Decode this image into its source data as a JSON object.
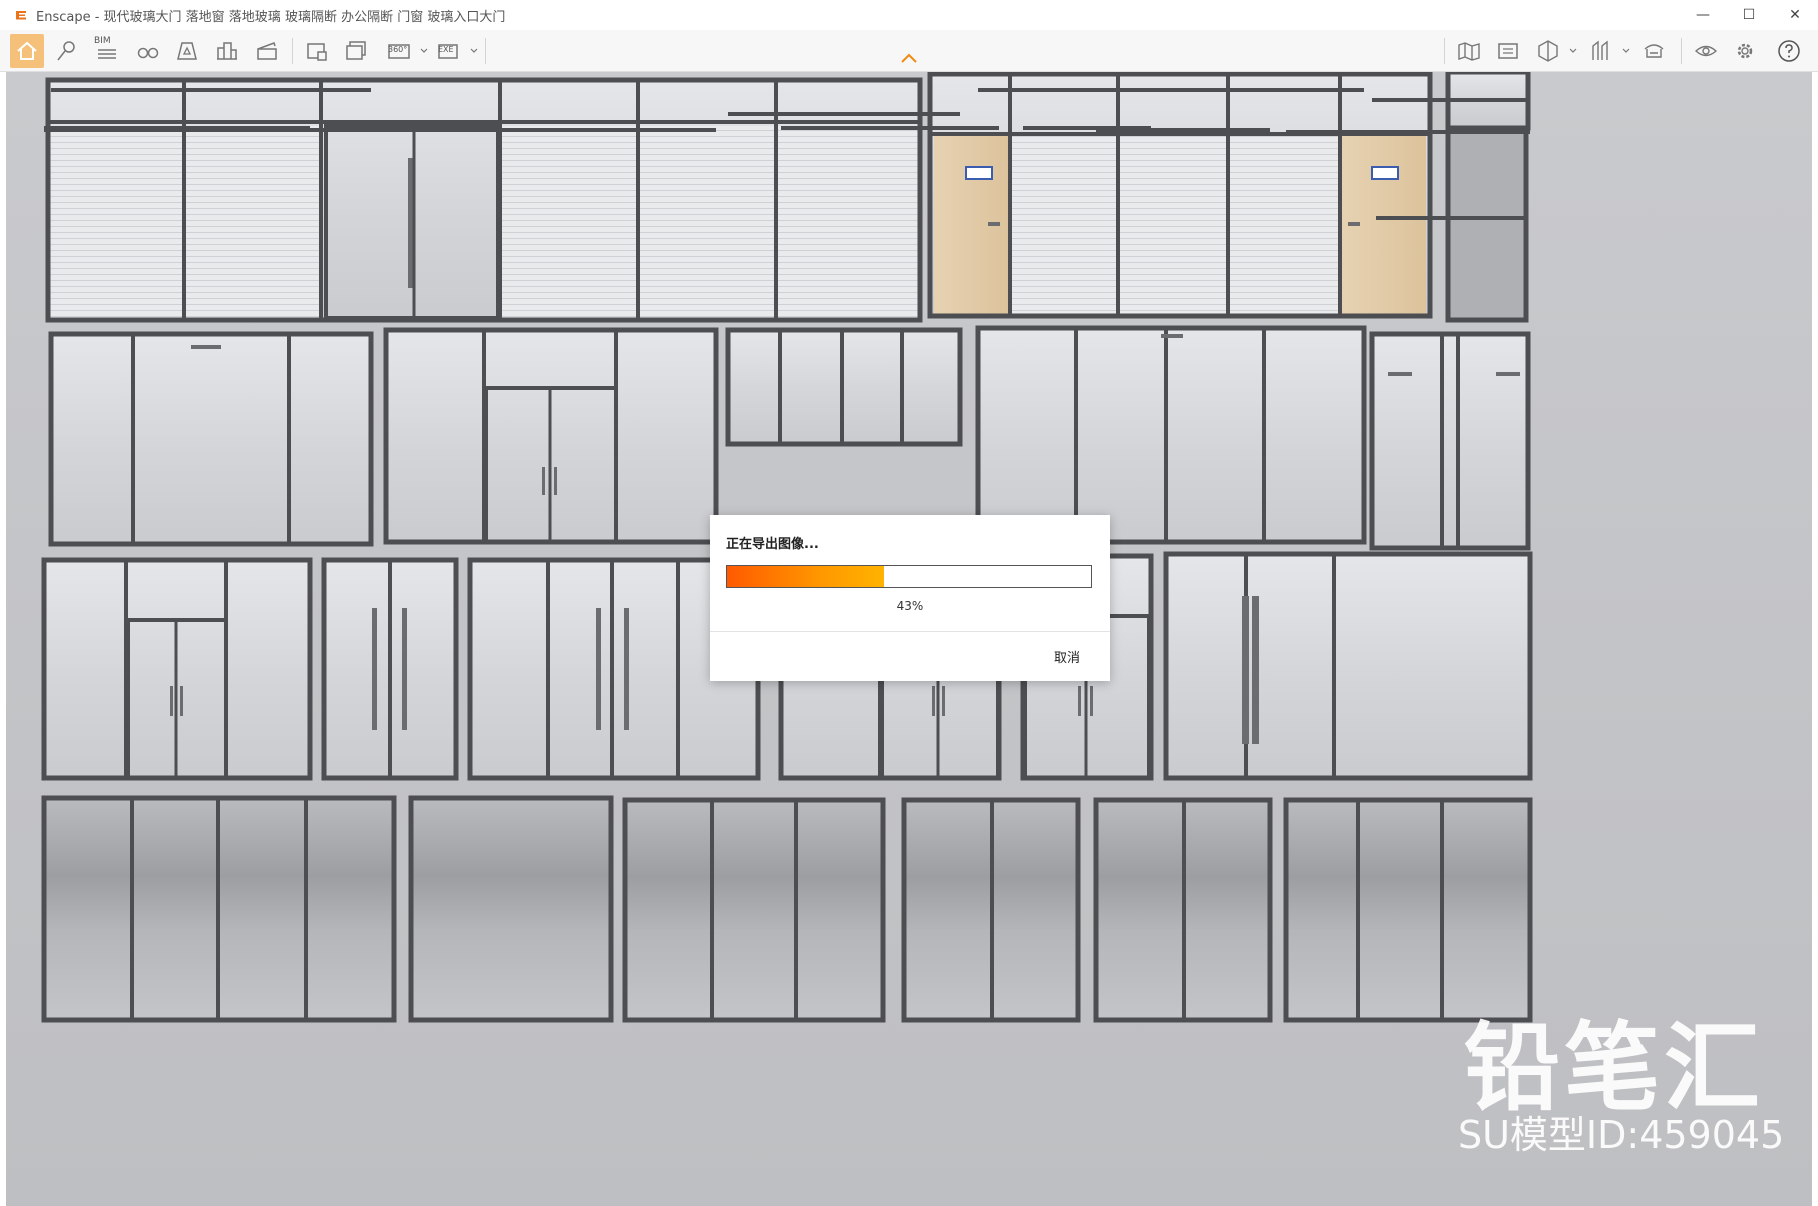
{
  "window": {
    "title": "Enscape - 现代玻璃大门 落地窗 落地玻璃 玻璃隔断 办公隔断 门窗 玻璃入口大门",
    "minimize": "—",
    "maximize": "☐",
    "close": "✕"
  },
  "toolbar": {
    "bim_label": "BIM",
    "pano_label": "360°",
    "exe_label": "EXE",
    "accent_color": "#f5c07a"
  },
  "dialog": {
    "title": "正在导出图像...",
    "progress": 0.43,
    "progress_text": "43%",
    "cancel_label": "取消"
  },
  "watermark": {
    "brand": "铅笔汇",
    "model_id": "SU模型ID:459045"
  }
}
